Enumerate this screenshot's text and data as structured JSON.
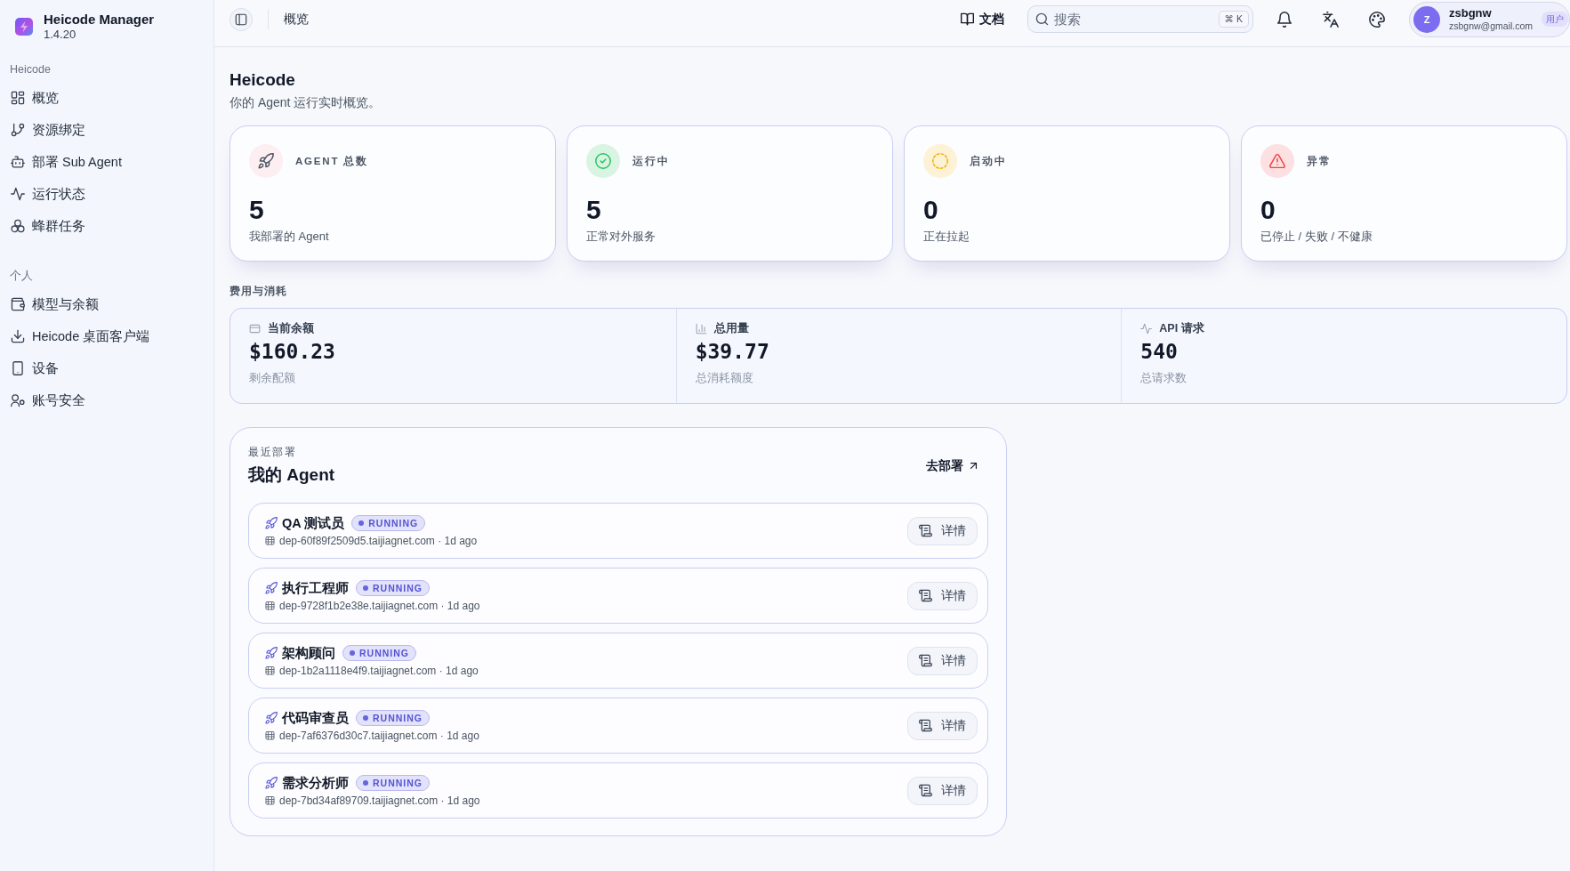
{
  "sidebar": {
    "app": {
      "name": "Heicode Manager",
      "version": "1.4.20"
    },
    "sections": [
      {
        "title": "Heicode",
        "items": [
          {
            "label": "概览"
          },
          {
            "label": "资源绑定"
          },
          {
            "label": "部署 Sub Agent"
          },
          {
            "label": "运行状态"
          },
          {
            "label": "蜂群任务"
          }
        ]
      },
      {
        "title": "个人",
        "items": [
          {
            "label": "模型与余额"
          },
          {
            "label": "Heicode 桌面客户端"
          },
          {
            "label": "设备"
          },
          {
            "label": "账号安全"
          }
        ]
      }
    ]
  },
  "topbar": {
    "breadcrumb": "概览",
    "docs_link": "文档",
    "search": {
      "placeholder": "搜索",
      "shortcut": "⌘ K"
    },
    "user": {
      "avatar_initial": "Z",
      "name": "zsbgnw",
      "email": "zsbgnw@gmail.com",
      "role": "用户"
    }
  },
  "page": {
    "title": "Heicode",
    "subtitle": "你的 Agent 运行实时概览。"
  },
  "stats": [
    {
      "kind": "total",
      "label": "AGENT 总数",
      "value": "5",
      "caption": "我部署的 Agent"
    },
    {
      "kind": "running",
      "label": "运行中",
      "value": "5",
      "caption": "正常对外服务"
    },
    {
      "kind": "starting",
      "label": "启动中",
      "value": "0",
      "caption": "正在拉起"
    },
    {
      "kind": "error",
      "label": "异常",
      "value": "0",
      "caption": "已停止 / 失败 / 不健康"
    }
  ],
  "costs": {
    "title": "费用与消耗",
    "items": [
      {
        "kind": "balance",
        "label": "当前余额",
        "value": "$160.23",
        "caption": "剩余配额"
      },
      {
        "kind": "usage",
        "label": "总用量",
        "value": "$39.77",
        "caption": "总消耗额度"
      },
      {
        "kind": "requests",
        "label": "API 请求",
        "value": "540",
        "caption": "总请求数"
      }
    ]
  },
  "agents": {
    "eyebrow": "最近部署",
    "title": "我的 Agent",
    "action": "去部署",
    "items": [
      {
        "name": "QA 测试员",
        "status": "RUNNING",
        "meta": "dep-60f89f2509d5.taijiagnet.com · 1d ago",
        "action": "详情"
      },
      {
        "name": "执行工程师",
        "status": "RUNNING",
        "meta": "dep-9728f1b2e38e.taijiagnet.com · 1d ago",
        "action": "详情"
      },
      {
        "name": "架构顾问",
        "status": "RUNNING",
        "meta": "dep-1b2a1118e4f9.taijiagnet.com · 1d ago",
        "action": "详情"
      },
      {
        "name": "代码审查员",
        "status": "RUNNING",
        "meta": "dep-7af6376d30c7.taijiagnet.com · 1d ago",
        "action": "详情"
      },
      {
        "name": "需求分析师",
        "status": "RUNNING",
        "meta": "dep-7bd34af89709.taijiagnet.com · 1d ago",
        "action": "详情"
      }
    ]
  }
}
